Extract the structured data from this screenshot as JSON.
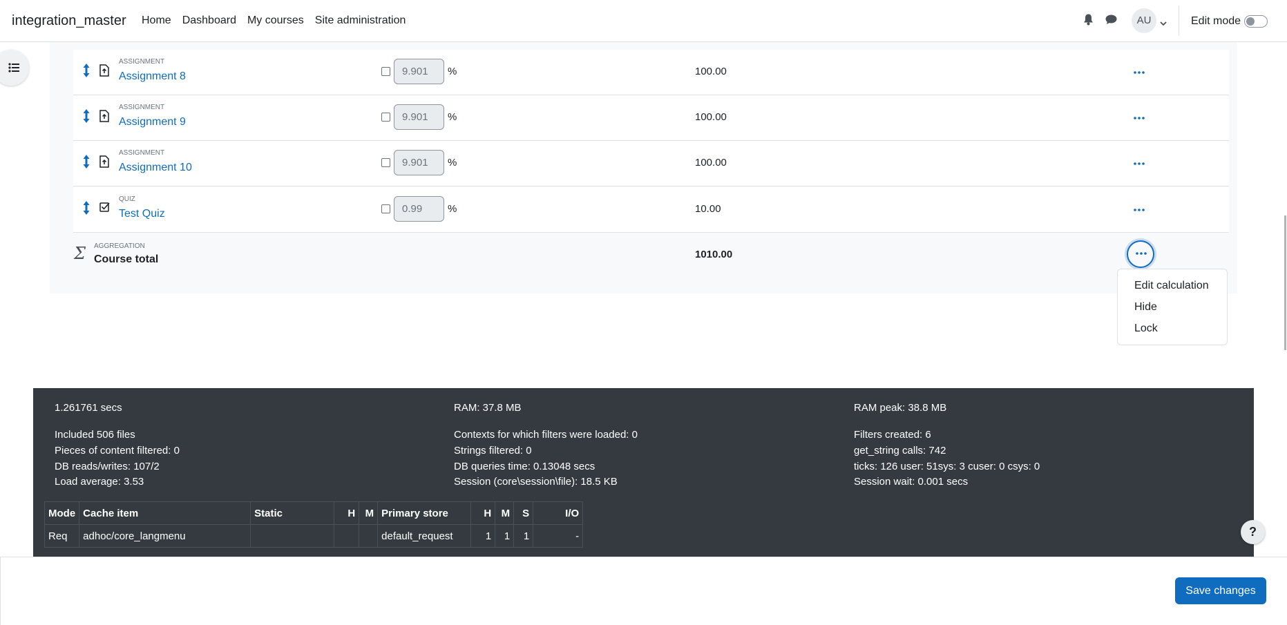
{
  "navbar": {
    "brand": "integration_master",
    "links": [
      "Home",
      "Dashboard",
      "My courses",
      "Site administration"
    ],
    "avatar_initials": "AU",
    "edit_mode_label": "Edit mode"
  },
  "grade_items": [
    {
      "type": "ASSIGNMENT",
      "name": "Assignment 8",
      "weight": "9.901",
      "pct": "%",
      "max": "100.00",
      "icon": "assignment-icon"
    },
    {
      "type": "ASSIGNMENT",
      "name": "Assignment 9",
      "weight": "9.901",
      "pct": "%",
      "max": "100.00",
      "icon": "assignment-icon"
    },
    {
      "type": "ASSIGNMENT",
      "name": "Assignment 10",
      "weight": "9.901",
      "pct": "%",
      "max": "100.00",
      "icon": "assignment-icon"
    },
    {
      "type": "QUIZ",
      "name": "Test Quiz",
      "weight": "0.99",
      "pct": "%",
      "max": "10.00",
      "icon": "quiz-icon"
    }
  ],
  "course_total": {
    "type": "AGGREGATION",
    "label": "Course total",
    "value": "1010.00"
  },
  "action_menu": {
    "items": [
      "Edit calculation",
      "Hide",
      "Lock"
    ]
  },
  "perf": {
    "col1": [
      "1.261761 secs",
      "Included 506 files",
      "Pieces of content filtered: 0",
      "DB reads/writes: 107/2",
      "Load average: 3.53"
    ],
    "col2": [
      "RAM: 37.8 MB",
      "Contexts for which filters were loaded: 0",
      "Strings filtered: 0",
      "DB queries time: 0.13048 secs",
      "Session (core\\session\\file): 18.5 KB"
    ],
    "col3": [
      "RAM peak: 38.8 MB",
      "Filters created: 6",
      "get_string calls: 742",
      "ticks: 126 user: 51sys: 3 cuser: 0 csys: 0",
      "Session wait: 0.001 secs"
    ],
    "cache_headers": [
      "Mode",
      "Cache item",
      "Static",
      "H",
      "M",
      "Primary store",
      "H",
      "M",
      "S",
      "I/O"
    ],
    "cache_row": [
      "Req",
      "adhoc/core_langmenu",
      "",
      "",
      "",
      "default_request",
      "1",
      "1",
      "1",
      "-"
    ]
  },
  "help_label": "?",
  "save_label": "Save changes",
  "colors": {
    "link": "#0f6cbf",
    "footer_bg": "#343a40",
    "primary": "#0f6cbf"
  }
}
